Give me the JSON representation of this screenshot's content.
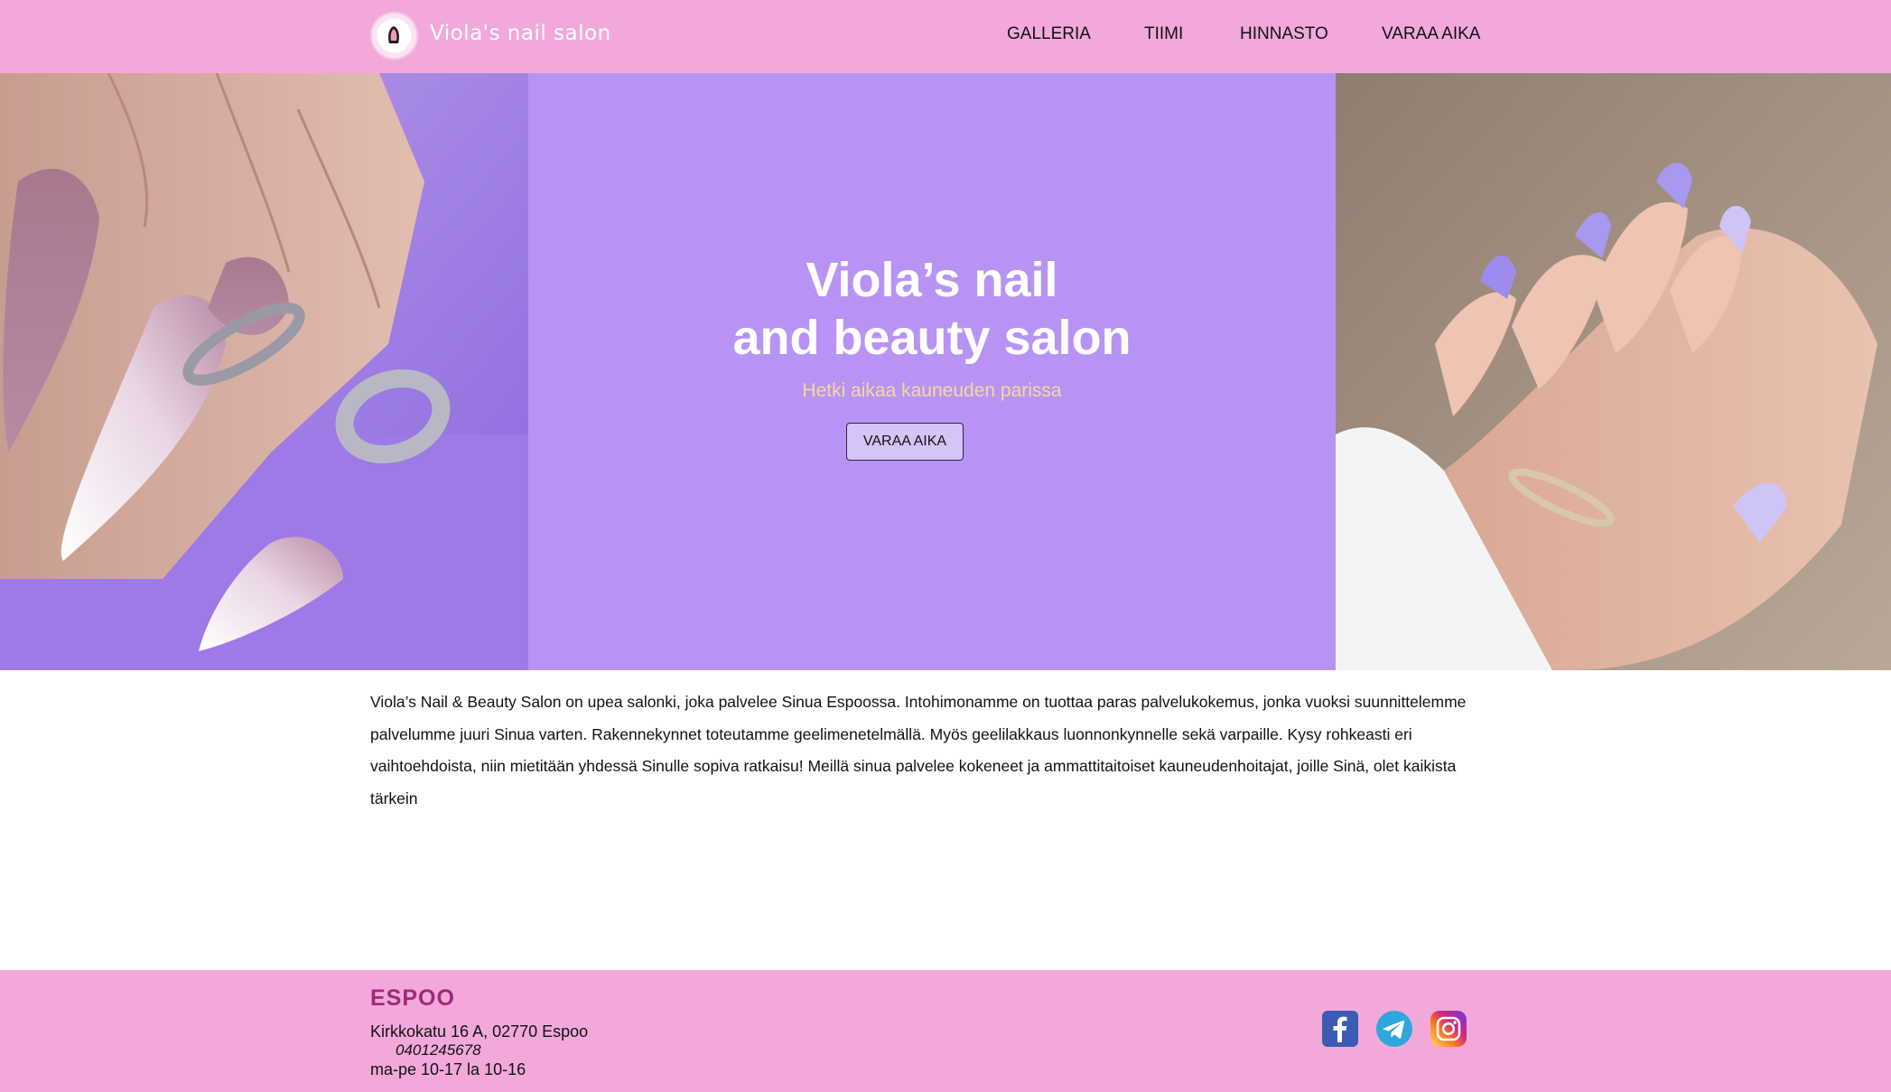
{
  "header": {
    "brand": "Viola's nail salon",
    "nav": [
      "GALLERIA",
      "TIIMI",
      "HINNASTO",
      "VARAA AIKA"
    ]
  },
  "hero": {
    "title_line1": "Viola’s nail",
    "title_line2": "and beauty salon",
    "subtitle": "Hetki aikaa kauneuden parissa",
    "button": "VARAA AIKA"
  },
  "intro": "Viola’s Nail & Beauty Salon on upea salonki, joka palvelee Sinua Espoossa. Intohimonamme on tuottaa paras palvelukokemus, jonka vuoksi suunnittelemme palvelumme juuri Sinua varten. Rakennekynnet toteutamme geelimenetelmällä. Myös geelilakkaus luonnonkynnelle sekä varpaille. Kysy rohkeasti eri vaihtoehdoista, niin mietitään yhdessä Sinulle sopiva ratkaisu! Meillä sinua palvelee kokeneet ja ammattitaitoiset kauneudenhoitajat, joille Sinä, olet kaikista tärkein",
  "footer": {
    "city": "ESPOO",
    "address": "Kirkkokatu 16 A, 02770 Espoo",
    "phone": "0401245678",
    "hours": "ma-pe 10-17 la 10-16"
  },
  "social": [
    "facebook-icon",
    "telegram-icon",
    "instagram-icon"
  ],
  "colors": {
    "header_bg": "#f2a9da",
    "hero_bg": "#b794f4",
    "subtitle": "#f6d99b",
    "city": "#a0297a"
  }
}
